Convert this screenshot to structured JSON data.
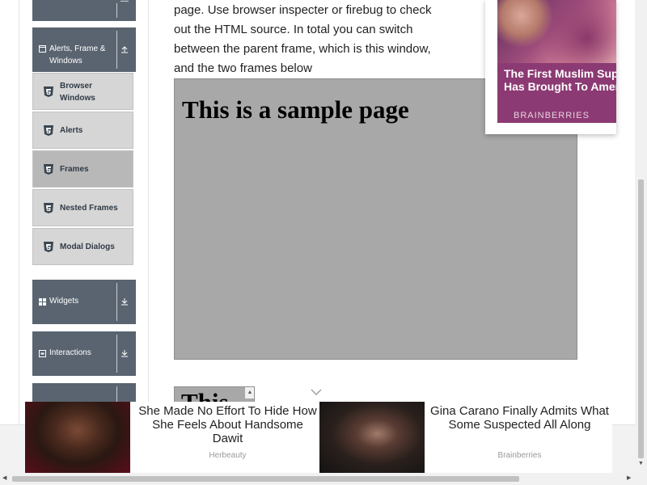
{
  "main": {
    "intro_lines": [
      "page. Use browser inspecter or firebug to check",
      "out the HTML source. In total you can switch",
      "between the parent frame, which is this window,",
      "and the two frames below"
    ],
    "frame_heading": "This is a sample page",
    "child_frame_text": "This"
  },
  "sidebar": {
    "group_alerts": {
      "label_line1": "Alerts, Frame &",
      "label_line2": "Windows",
      "icon": "window-icon",
      "arrow": "collapse-up-icon"
    },
    "sub_items": [
      {
        "label_line1": "Browser",
        "label_line2": "Windows"
      },
      {
        "label": "Alerts"
      },
      {
        "label": "Frames",
        "active": true
      },
      {
        "label": "Nested Frames"
      },
      {
        "label": "Modal Dialogs"
      }
    ],
    "group_widgets": {
      "label": "Widgets",
      "icon": "grid-icon",
      "arrow": "expand-down-icon"
    },
    "group_interactions": {
      "label": "Interactions",
      "icon": "square-icon",
      "arrow": "expand-down-icon"
    }
  },
  "ads": {
    "top_right": {
      "title": "The First Muslim Superh Has Brought To America",
      "brand": "BRAINBERRIES"
    },
    "bottom": [
      {
        "title": "She Made No Effort To Hide How She Feels About Handsome Dawit",
        "source": "Herbeauty"
      },
      {
        "title": "Gina Carano Finally Admits What Some Suspected All Along",
        "source": "Brainberries"
      }
    ]
  },
  "colors": {
    "sidebar_group_bg": "#5a6470",
    "sub_item_bg": "#d6d6d6",
    "sub_item_active_bg": "#b8b8b8",
    "frame_bg": "#a8a8a8",
    "ad_caption_bg": "#8c3a73"
  }
}
